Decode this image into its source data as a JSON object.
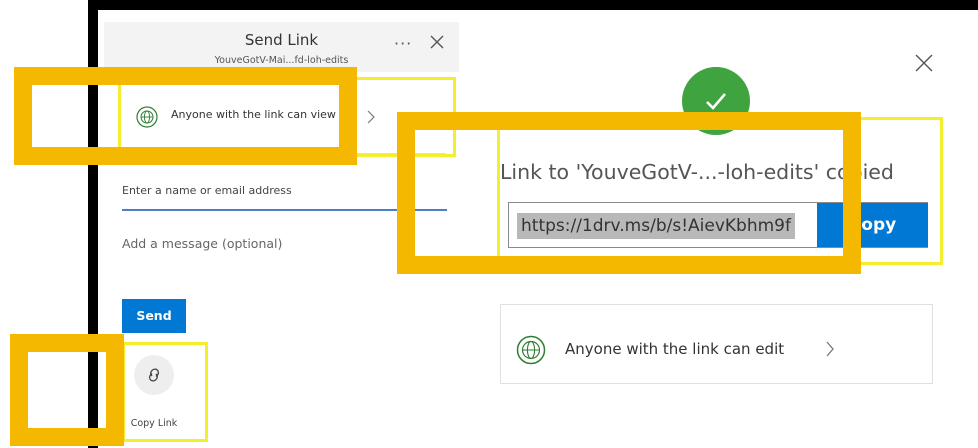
{
  "send_panel": {
    "title": "Send Link",
    "subtitle": "YouveGotV-Mai...fd-loh-edits",
    "more_label": "···",
    "permission_text": "Anyone with the link can view",
    "email_placeholder": "Enter a name or email address",
    "message_placeholder": "Add a message (optional)",
    "send_label": "Send",
    "copy_link_label": "Copy Link"
  },
  "copied_panel": {
    "confirmation": "Link to 'YouveGotV-...-loh-edits' copied",
    "url": "https://1drv.ms/b/s!AievKbhm9f",
    "copy_label": "Copy",
    "permission_text": "Anyone with the link can edit"
  },
  "colors": {
    "accent": "#0078d4",
    "success": "#3fa33f",
    "highlight_yellow": "#f5ee2e",
    "highlight_orange": "#f5b800"
  },
  "icons": [
    "globe-icon",
    "chevron-right-icon",
    "close-icon",
    "link-icon",
    "checkmark-icon",
    "more-icon"
  ]
}
